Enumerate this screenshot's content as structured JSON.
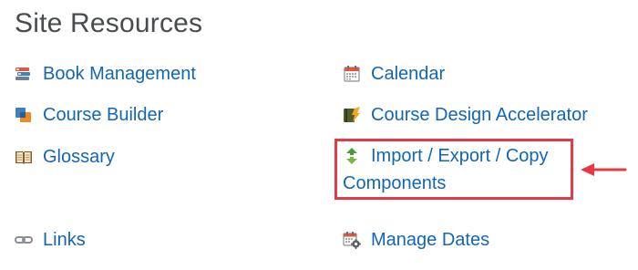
{
  "section": {
    "title": "Site Resources"
  },
  "items": {
    "book_management": {
      "label": "Book Management",
      "icon": "books-icon"
    },
    "calendar": {
      "label": "Calendar",
      "icon": "calendar-icon"
    },
    "course_builder": {
      "label": "Course Builder",
      "icon": "course-builder-icon"
    },
    "course_design_accelerator": {
      "label": "Course Design Accelerator",
      "icon": "accelerator-icon"
    },
    "glossary": {
      "label": "Glossary",
      "icon": "book-open-icon"
    },
    "import_export_copy": {
      "label": "Import / Export / Copy Components",
      "icon": "import-export-arrows-icon"
    },
    "links": {
      "label": "Links",
      "icon": "chain-link-icon"
    },
    "manage_dates": {
      "label": "Manage Dates",
      "icon": "calendar-gear-icon"
    }
  },
  "annotation": {
    "highlight_color": "#e43a45",
    "arrow_icon": "left-arrow-icon"
  },
  "colors": {
    "link": "#1266b5",
    "title": "#494c4e"
  }
}
